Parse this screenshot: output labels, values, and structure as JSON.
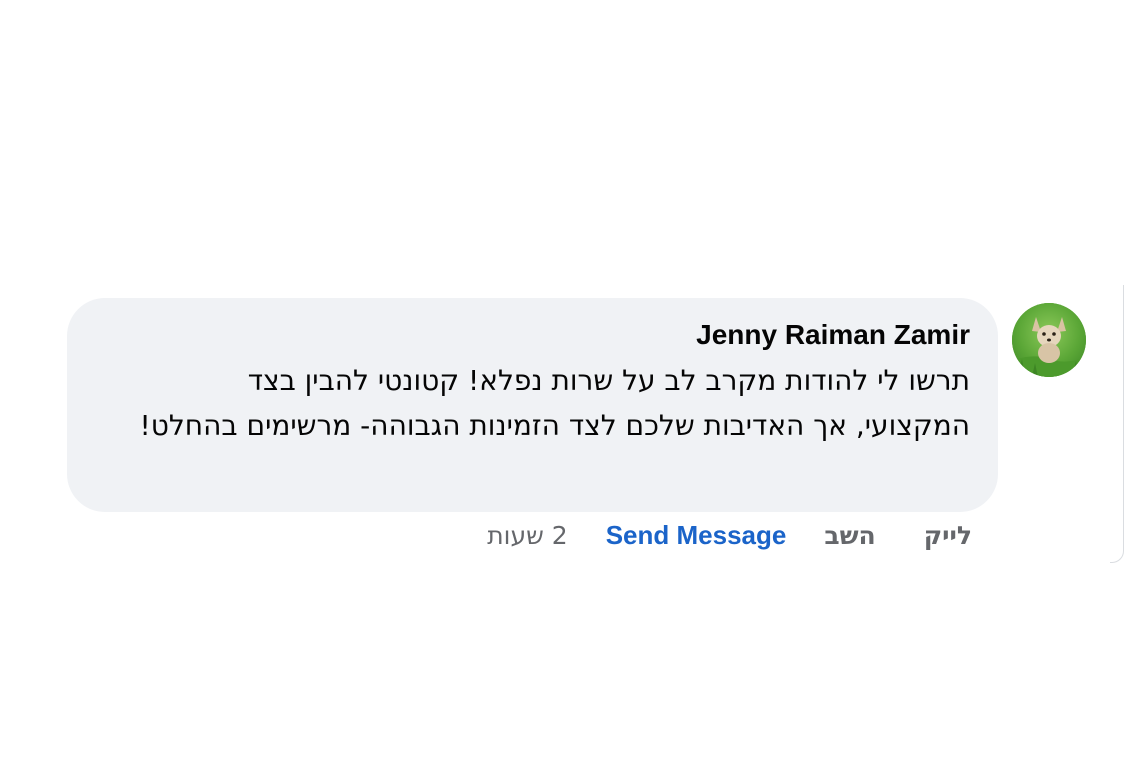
{
  "comment": {
    "author": "Jenny Raiman Zamir",
    "text": "תרשו לי להודות מקרב לב על שרות נפלא! קטונטי להבין בצד המקצועי, אך האדיבות שלכם לצד הזמינות הגבוהה- מרשימים בהחלט!",
    "avatar": "dog-in-grass"
  },
  "actions": {
    "like_label": "לייק",
    "reply_label": "השב",
    "send_message_label": "Send Message",
    "timestamp": "2 שעות"
  },
  "colors": {
    "bubble_bg": "#f0f2f5",
    "action_gray": "#65676b",
    "link_blue": "#1b64c9",
    "text": "#050505"
  }
}
